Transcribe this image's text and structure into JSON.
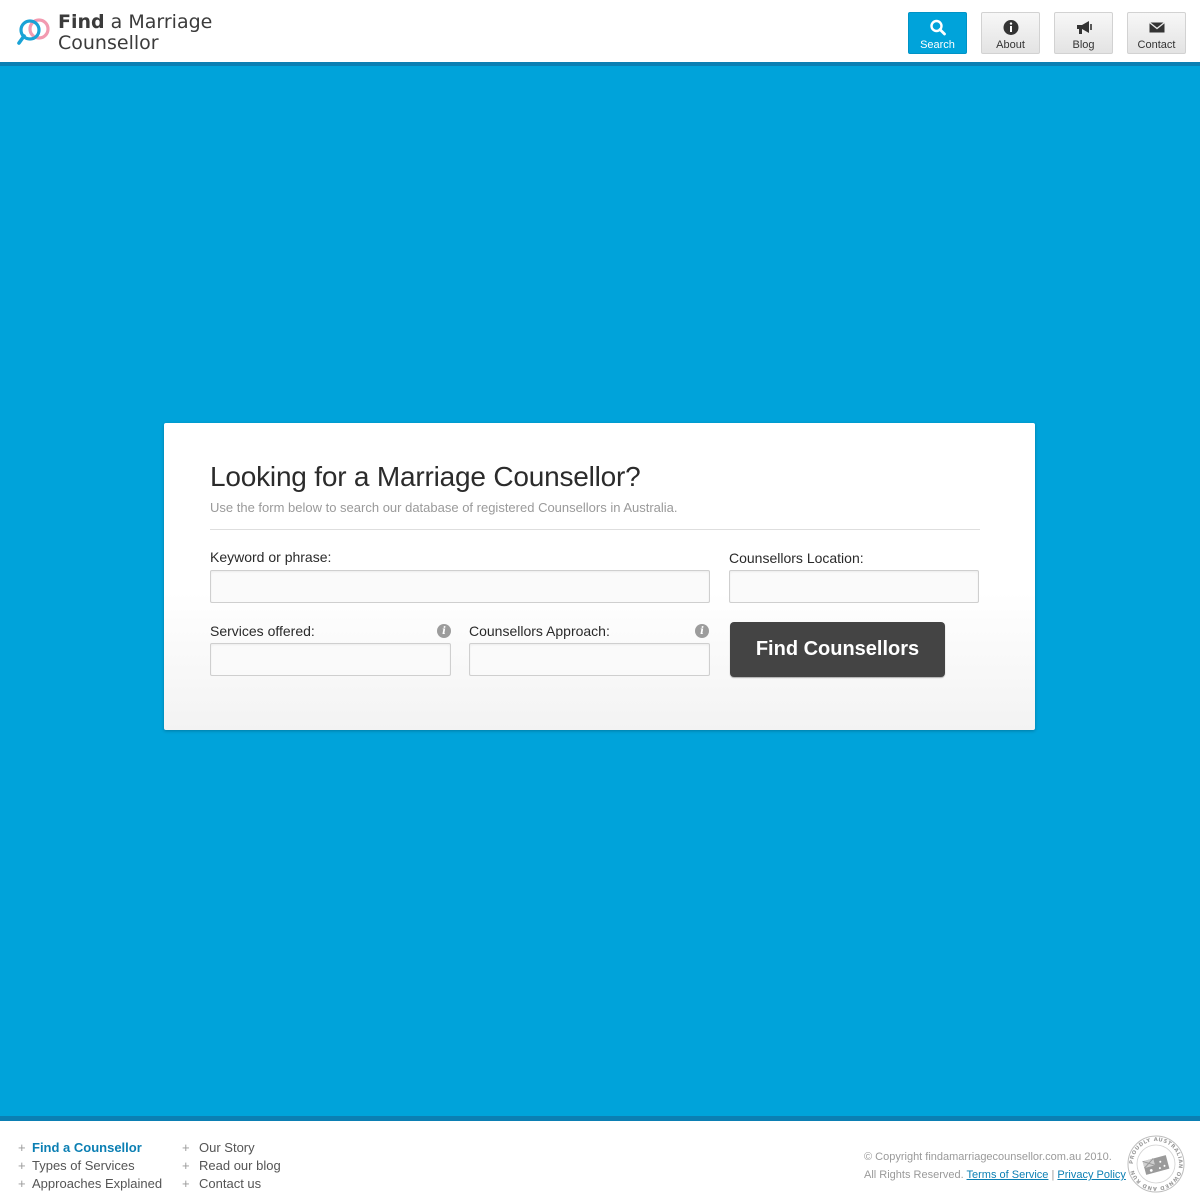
{
  "header": {
    "logo": {
      "find": "Find",
      "rest": " a Marriage",
      "line2": "Counsellor"
    },
    "nav": [
      {
        "label": "Search",
        "icon": "search-icon",
        "active": true
      },
      {
        "label": "About",
        "icon": "info-icon",
        "active": false
      },
      {
        "label": "Blog",
        "icon": "megaphone-icon",
        "active": false
      },
      {
        "label": "Contact",
        "icon": "envelope-icon",
        "active": false
      }
    ]
  },
  "card": {
    "title": "Looking for a Marriage Counsellor?",
    "subtitle": "Use the form below to search our database of registered Counsellors in Australia.",
    "keyword": {
      "label": "Keyword or phrase:",
      "value": ""
    },
    "location": {
      "label": "Counsellors Location:",
      "value": ""
    },
    "services": {
      "label": "Services offered:",
      "value": ""
    },
    "approach": {
      "label": "Counsellors Approach:",
      "value": ""
    },
    "submit": "Find Counsellors"
  },
  "footer": {
    "col1": [
      {
        "label": "Find a Counsellor",
        "current": true
      },
      {
        "label": "Types of Services",
        "current": false
      },
      {
        "label": "Approaches Explained",
        "current": false
      }
    ],
    "col2": [
      {
        "label": "Our Story"
      },
      {
        "label": "Read our blog"
      },
      {
        "label": "Contact us"
      }
    ],
    "copyright": "© Copyright findamarriagecounsellor.com.au 2010.",
    "rights": "All Rights Reserved.",
    "terms": "Terms of Service",
    "separator": "|",
    "privacy": "Privacy Policy",
    "seal_text": "PROUDLY AUSTRALIAN OWNED AND RUN"
  },
  "colors": {
    "brand_blue": "#00a3da",
    "dark_blue": "#0b7fb3",
    "button_dark": "#444444"
  }
}
